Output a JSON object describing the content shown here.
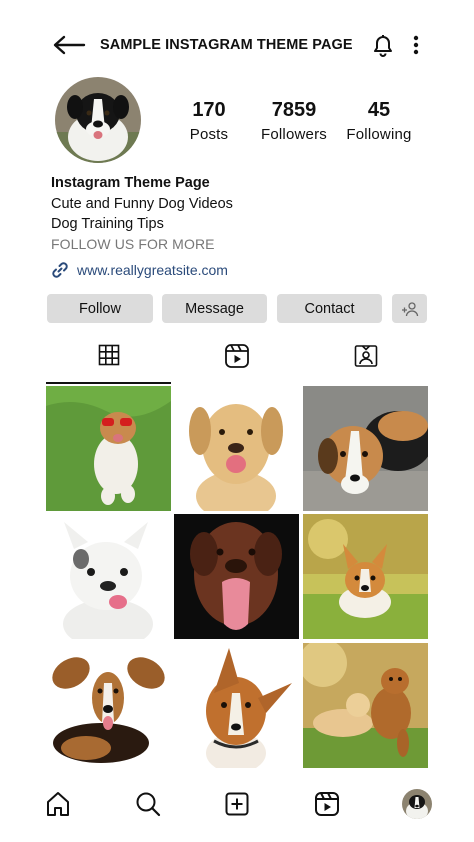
{
  "header": {
    "title": "SAMPLE INSTAGRAM THEME PAGE",
    "back_icon": "arrow-left-icon",
    "notification_icon": "bell-icon",
    "menu_icon": "more-vertical-icon"
  },
  "profile": {
    "stats": [
      {
        "value": "170",
        "label": "Posts"
      },
      {
        "value": "7859",
        "label": "Followers"
      },
      {
        "value": "45",
        "label": "Following"
      }
    ],
    "name": "Instagram Theme Page",
    "bio_lines": [
      "Cute and Funny Dog Videos",
      "Dog Training Tips"
    ],
    "call_to_action": "FOLLOW US FOR MORE",
    "link_text": "www.reallygreatsite.com"
  },
  "actions": {
    "follow": "Follow",
    "message": "Message",
    "contact": "Contact",
    "add_person_icon": "add-person-icon"
  },
  "tabs": [
    {
      "icon": "grid-icon",
      "active": true
    },
    {
      "icon": "reels-icon",
      "active": false
    },
    {
      "icon": "tagged-icon",
      "active": false
    }
  ],
  "bottom_nav": [
    "home-icon",
    "search-icon",
    "create-icon",
    "reels-icon",
    "profile-avatar"
  ],
  "colors": {
    "button_bg": "#dcdcdc",
    "link": "#2a4a7a",
    "muted_text": "#777777"
  }
}
